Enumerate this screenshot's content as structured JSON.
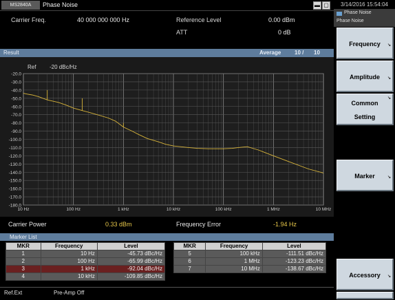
{
  "window": {
    "app_chip": "MS2840A",
    "title": "Phase Noise",
    "controls": [
      "▬",
      "▢"
    ]
  },
  "info": {
    "carrier_freq_label": "Carrier Freq.",
    "carrier_freq_value": "40 000 000 000 Hz",
    "ref_level_label": "Reference Level",
    "ref_level_value": "0.00 dBm",
    "att_label": "ATT",
    "att_value": "0 dB"
  },
  "result_bar": {
    "label": "Result",
    "average_label": "Average",
    "average_count": "10 /",
    "average_total": "10"
  },
  "graph": {
    "ref_label": "Ref",
    "ref_value": "-20 dBc/Hz"
  },
  "chart_data": {
    "type": "line",
    "title": "",
    "xlabel": "",
    "ylabel": "",
    "x_scale": "log",
    "xlim": [
      10,
      10000000
    ],
    "ylim": [
      -180,
      -20
    ],
    "grid": true,
    "x_ticks": [
      "10 Hz",
      "100 Hz",
      "1 kHz",
      "10 kHz",
      "100 kHz",
      "1 MHz",
      "10 MHz"
    ],
    "y_ticks": [
      "-20.0",
      "-30.0",
      "-40.0",
      "-50.0",
      "-60.0",
      "-70.0",
      "-80.0",
      "-90.0",
      "-100.0",
      "-110.0",
      "-120.0",
      "-130.0",
      "-140.0",
      "-150.0",
      "-160.0",
      "-170.0",
      "-180.0"
    ],
    "series": [
      {
        "color": "#d8b43a",
        "x": [
          10,
          12,
          15,
          20,
          30,
          50,
          70,
          100,
          150,
          200,
          300,
          500,
          700,
          1000,
          1500,
          2000,
          3000,
          5000,
          7000,
          10000,
          20000,
          30000,
          50000,
          100000,
          150000,
          200000,
          300000,
          500000,
          1000000,
          2000000,
          5000000,
          10000000
        ],
        "y": [
          -44,
          -45,
          -46,
          -48,
          -52,
          -55,
          -58,
          -62,
          -65,
          -67,
          -70,
          -74,
          -78,
          -85,
          -90,
          -94,
          -99,
          -103,
          -106,
          -108,
          -110,
          -111,
          -111.5,
          -111.5,
          -111,
          -110,
          -109,
          -113,
          -120,
          -127,
          -136,
          -141
        ]
      }
    ],
    "spurs": [
      {
        "x": 30,
        "y": -40
      },
      {
        "x": 60,
        "y": -57
      },
      {
        "x": 100,
        "y": -62
      },
      {
        "x": 150,
        "y": -50
      },
      {
        "x": 1000,
        "y": -80
      }
    ]
  },
  "summary": {
    "carrier_power_label": "Carrier Power",
    "carrier_power_value": "0.33 dBm",
    "freq_error_label": "Frequency Error",
    "freq_error_value": "-1.94 Hz"
  },
  "marker_list": {
    "title": "Marker List",
    "headers": [
      "MKR",
      "Frequency",
      "Level"
    ],
    "left": [
      [
        "1",
        "10 Hz",
        "-45.73 dBc/Hz"
      ],
      [
        "2",
        "100 Hz",
        "-65.99 dBc/Hz"
      ],
      [
        "3",
        "1 kHz",
        "-92.04 dBc/Hz"
      ],
      [
        "4",
        "10 kHz",
        "-109.85 dBc/Hz"
      ]
    ],
    "right": [
      [
        "5",
        "100 kHz",
        "-111.51 dBc/Hz"
      ],
      [
        "6",
        "1 MHz",
        "-123.23 dBc/Hz"
      ],
      [
        "7",
        "10 MHz",
        "-138.67 dBc/Hz"
      ]
    ]
  },
  "status": {
    "ref_ext": "Ref.Ext",
    "pre_amp": "Pre-Amp Off"
  },
  "side": {
    "datetime": "3/14/2016 15:54:04",
    "app_name": "Phase Noise",
    "menu_title": "Phase Noise",
    "softkeys": [
      "Frequency",
      "Amplitude",
      "Common",
      "Setting",
      "Marker",
      "Accessory"
    ]
  },
  "colors": {
    "trace": "#d8b43a",
    "bar_blue": "#5e7c9c",
    "softkey_bg": "#cfd8e0",
    "marker_selected": "#6a2020"
  }
}
